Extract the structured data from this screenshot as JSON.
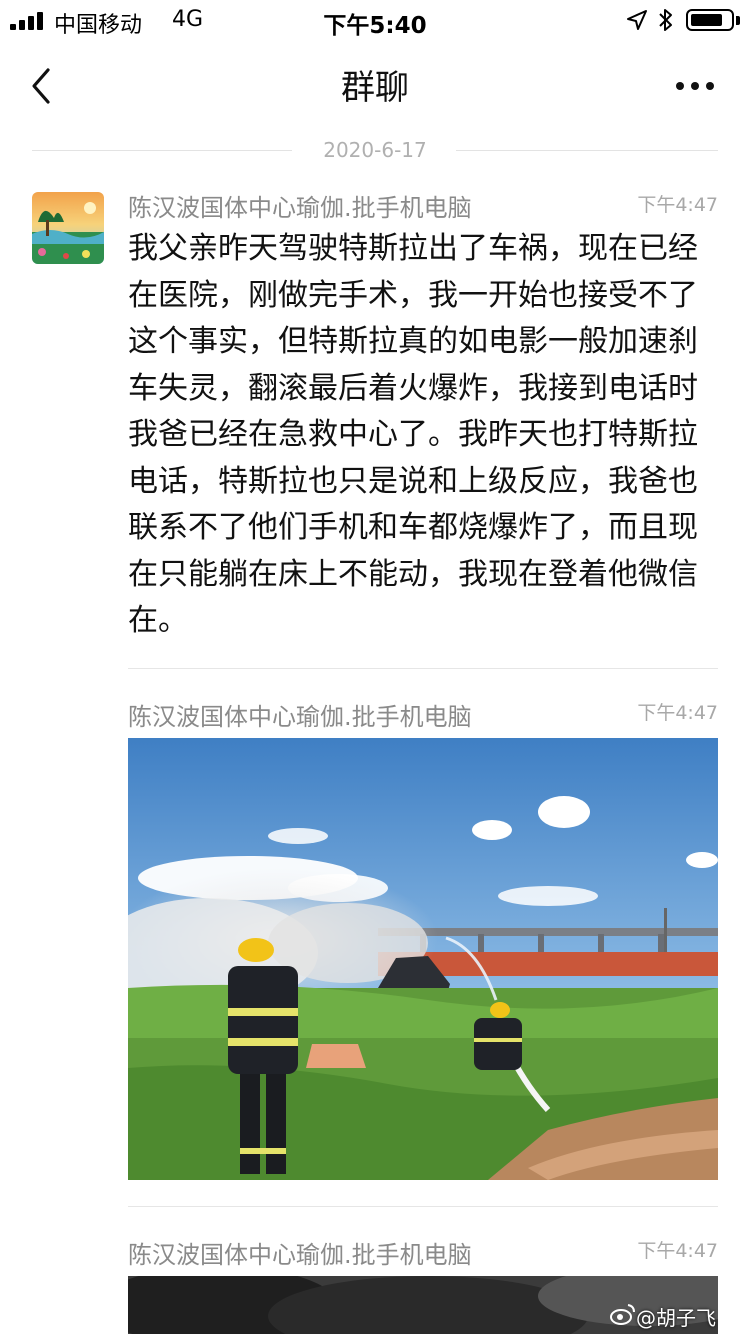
{
  "status_bar": {
    "carrier": "中国移动",
    "network": "4G",
    "time": "下午5:40"
  },
  "nav": {
    "title": "群聊",
    "back_icon": "chevron-left-icon",
    "more_icon": "more-dots-icon"
  },
  "date_divider": "2020-6-17",
  "messages": [
    {
      "sender": "陈汉波国体中心瑜伽.批手机电脑",
      "time": "下午4:47",
      "text": "我父亲昨天驾驶特斯拉出了车祸，现在已经在医院，刚做完手术，我一开始也接受不了这个事实，但特斯拉真的如电影一般加速刹车失灵，翻滚最后着火爆炸，我接到电话时我爸已经在急救中心了。我昨天也打特斯拉电话，特斯拉也只是说和上级反应，我爸也联系不了他们手机和车都烧爆炸了，而且现在只能躺在床上不能动，我现在登着他微信在。"
    },
    {
      "sender": "陈汉波国体中心瑜伽.批手机电脑",
      "time": "下午4:47",
      "image_alt": "photo-firefighters-car-fire"
    },
    {
      "sender": "陈汉波国体中心瑜伽.批手机电脑",
      "time": "下午4:47",
      "image_alt": "photo-black-smoke"
    }
  ],
  "watermark": "@胡子飞",
  "colors": {
    "sender_gray": "#8a8a8a",
    "time_gray": "#a8a8a8",
    "separator": "#e6e6e6"
  }
}
